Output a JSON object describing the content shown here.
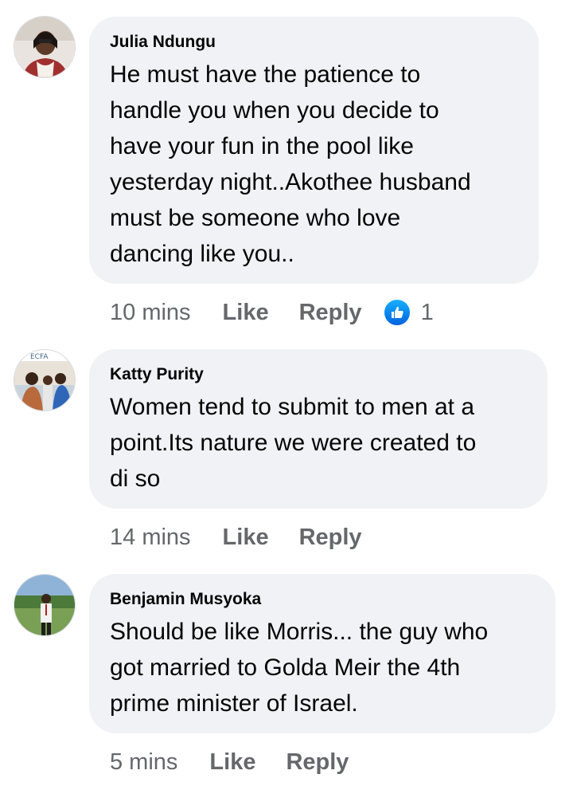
{
  "comments": [
    {
      "author": "Julia Ndungu",
      "text": "He must have the patience to\nhandle you when you decide to\nhave your fun in the pool like\nyesterday night..Akothee husband\nmust be someone who love\ndancing like you..",
      "time": "10 mins",
      "like_label": "Like",
      "reply_label": "Reply",
      "reaction_icon": "like-reaction-icon",
      "reaction_count": "1"
    },
    {
      "author": "Katty Purity",
      "text": "Women tend to submit to men at a\npoint.Its nature we were created to\ndi so",
      "time": "14 mins",
      "like_label": "Like",
      "reply_label": "Reply"
    },
    {
      "author": "Benjamin Musyoka",
      "text": "Should be like Morris... the guy who\ngot married to Golda Meir the 4th\nprime minister of Israel.",
      "time": "5 mins",
      "like_label": "Like",
      "reply_label": "Reply"
    }
  ],
  "colors": {
    "bubble": "#f0f2f5",
    "meta_text": "#65676b",
    "like_blue": "#1877f2"
  }
}
